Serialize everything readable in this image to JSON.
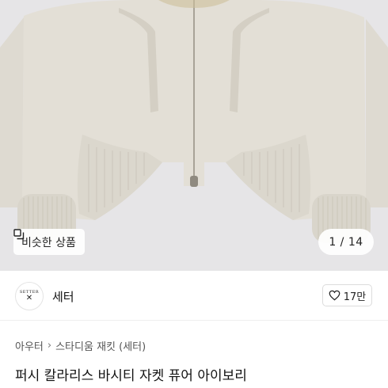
{
  "gallery": {
    "image_alt": "jacket-photo",
    "similar_label": "비슷한 상품",
    "counter": "1 / 14"
  },
  "shop": {
    "name": "세터",
    "logo_text": "SETTER",
    "logo_mark": "✕"
  },
  "like": {
    "count": "17만"
  },
  "breadcrumb": {
    "items": [
      "아우터",
      "스타디움 재킷 (세터)"
    ],
    "separator": "›"
  },
  "product": {
    "title": "퍼시 칼라리스 바시티 자켓 퓨어 아이보리"
  },
  "colors": {
    "background": "#e6e5e7",
    "jacket": "#e3dfd6",
    "rib": "#dcd8ce"
  }
}
